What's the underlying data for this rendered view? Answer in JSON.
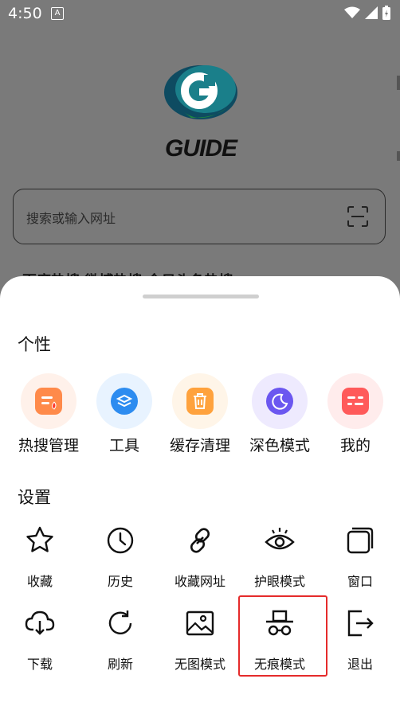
{
  "status": {
    "time": "4:50",
    "notif_glyph": "A"
  },
  "background": {
    "logo_text": "GUIDE",
    "search_placeholder": "搜索或输入网址",
    "hot_tabs": "百度热搜   微博热搜   今日头条热搜"
  },
  "sheet": {
    "personal": {
      "title": "个性",
      "items": [
        {
          "label": "热搜管理",
          "icon": "hot-search-icon",
          "bg": "#fff1ea",
          "tile": "#ff8a4a"
        },
        {
          "label": "工具",
          "icon": "tools-layers-icon",
          "bg": "#e8f3ff",
          "tile": "#2d8cf0"
        },
        {
          "label": "缓存清理",
          "icon": "trash-icon",
          "bg": "#fff5e8",
          "tile": "#ffa23d"
        },
        {
          "label": "深色模式",
          "icon": "moon-icon",
          "bg": "#eeeafe",
          "tile": "#6b57f0"
        },
        {
          "label": "我的",
          "icon": "profile-card-icon",
          "bg": "#ffecec",
          "tile": "#ff5a5a"
        }
      ]
    },
    "settings": {
      "title": "设置",
      "row1": [
        {
          "label": "收藏",
          "icon": "star-icon"
        },
        {
          "label": "历史",
          "icon": "clock-icon"
        },
        {
          "label": "收藏网址",
          "icon": "link-icon"
        },
        {
          "label": "护眼模式",
          "icon": "eye-icon"
        },
        {
          "label": "窗口",
          "icon": "windows-icon"
        }
      ],
      "row2": [
        {
          "label": "下载",
          "icon": "cloud-download-icon"
        },
        {
          "label": "刷新",
          "icon": "refresh-icon"
        },
        {
          "label": "无图模式",
          "icon": "image-icon"
        },
        {
          "label": "无痕模式",
          "icon": "incognito-icon"
        },
        {
          "label": "退出",
          "icon": "exit-icon"
        }
      ]
    }
  }
}
